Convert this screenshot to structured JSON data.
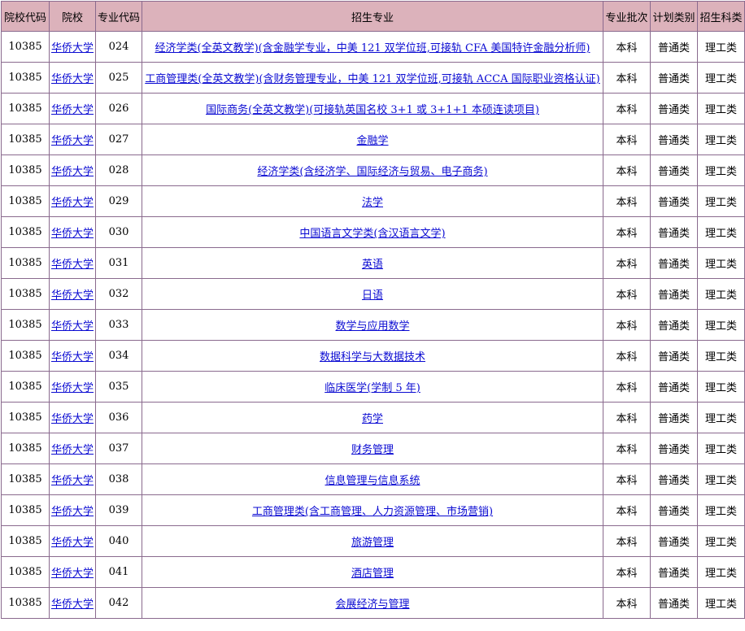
{
  "headers": [
    "院校代码",
    "院校",
    "专业代码",
    "招生专业",
    "专业批次",
    "计划类别",
    "招生科类"
  ],
  "rows": [
    {
      "school_code": "10385",
      "school": "华侨大学",
      "major_code": "024",
      "major": "经济学类(全英文教学)(含金融学专业，中美 121 双学位班,可接轨 CFA 美国特许金融分析师)",
      "batch": "本科",
      "plan": "普通类",
      "category": "理工类"
    },
    {
      "school_code": "10385",
      "school": "华侨大学",
      "major_code": "025",
      "major": "工商管理类(全英文教学)(含财务管理专业，中美 121 双学位班,可接轨 ACCA 国际职业资格认证)",
      "batch": "本科",
      "plan": "普通类",
      "category": "理工类"
    },
    {
      "school_code": "10385",
      "school": "华侨大学",
      "major_code": "026",
      "major": "国际商务(全英文教学)(可接轨英国名校 3+1 或 3+1+1 本硕连读项目)",
      "batch": "本科",
      "plan": "普通类",
      "category": "理工类"
    },
    {
      "school_code": "10385",
      "school": "华侨大学",
      "major_code": "027",
      "major": "金融学",
      "batch": "本科",
      "plan": "普通类",
      "category": "理工类"
    },
    {
      "school_code": "10385",
      "school": "华侨大学",
      "major_code": "028",
      "major": "经济学类(含经济学、国际经济与贸易、电子商务)",
      "batch": "本科",
      "plan": "普通类",
      "category": "理工类"
    },
    {
      "school_code": "10385",
      "school": "华侨大学",
      "major_code": "029",
      "major": "法学",
      "batch": "本科",
      "plan": "普通类",
      "category": "理工类"
    },
    {
      "school_code": "10385",
      "school": "华侨大学",
      "major_code": "030",
      "major": "中国语言文学类(含汉语言文学)",
      "batch": "本科",
      "plan": "普通类",
      "category": "理工类"
    },
    {
      "school_code": "10385",
      "school": "华侨大学",
      "major_code": "031",
      "major": "英语",
      "batch": "本科",
      "plan": "普通类",
      "category": "理工类"
    },
    {
      "school_code": "10385",
      "school": "华侨大学",
      "major_code": "032",
      "major": "日语",
      "batch": "本科",
      "plan": "普通类",
      "category": "理工类"
    },
    {
      "school_code": "10385",
      "school": "华侨大学",
      "major_code": "033",
      "major": "数学与应用数学",
      "batch": "本科",
      "plan": "普通类",
      "category": "理工类"
    },
    {
      "school_code": "10385",
      "school": "华侨大学",
      "major_code": "034",
      "major": "数据科学与大数据技术",
      "batch": "本科",
      "plan": "普通类",
      "category": "理工类"
    },
    {
      "school_code": "10385",
      "school": "华侨大学",
      "major_code": "035",
      "major": "临床医学(学制 5 年)",
      "batch": "本科",
      "plan": "普通类",
      "category": "理工类"
    },
    {
      "school_code": "10385",
      "school": "华侨大学",
      "major_code": "036",
      "major": "药学",
      "batch": "本科",
      "plan": "普通类",
      "category": "理工类"
    },
    {
      "school_code": "10385",
      "school": "华侨大学",
      "major_code": "037",
      "major": "财务管理",
      "batch": "本科",
      "plan": "普通类",
      "category": "理工类"
    },
    {
      "school_code": "10385",
      "school": "华侨大学",
      "major_code": "038",
      "major": "信息管理与信息系统",
      "batch": "本科",
      "plan": "普通类",
      "category": "理工类"
    },
    {
      "school_code": "10385",
      "school": "华侨大学",
      "major_code": "039",
      "major": "工商管理类(含工商管理、人力资源管理、市场营销)",
      "batch": "本科",
      "plan": "普通类",
      "category": "理工类"
    },
    {
      "school_code": "10385",
      "school": "华侨大学",
      "major_code": "040",
      "major": "旅游管理",
      "batch": "本科",
      "plan": "普通类",
      "category": "理工类"
    },
    {
      "school_code": "10385",
      "school": "华侨大学",
      "major_code": "041",
      "major": "酒店管理",
      "batch": "本科",
      "plan": "普通类",
      "category": "理工类"
    },
    {
      "school_code": "10385",
      "school": "华侨大学",
      "major_code": "042",
      "major": "会展经济与管理",
      "batch": "本科",
      "plan": "普通类",
      "category": "理工类"
    }
  ]
}
